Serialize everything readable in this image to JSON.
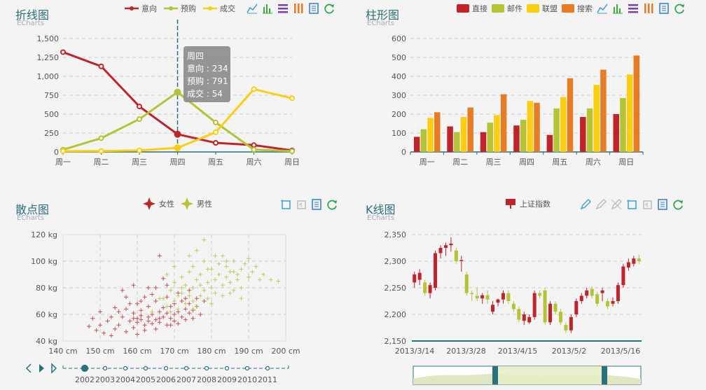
{
  "colors": {
    "red": "#c1232b",
    "green": "#b5c334",
    "yellow": "#fcce10",
    "orange": "#e87c25",
    "teal": "#27727b",
    "tooltipBg": "#8f8f8f"
  },
  "toolbox_icons": {
    "line": [
      "line-chart-icon",
      "bar-chart-icon",
      "stack-icon",
      "tiled-icon",
      "data-view-icon",
      "restore-icon"
    ],
    "bar": [
      "line-chart-icon",
      "bar-chart-icon",
      "stack-icon",
      "tiled-icon",
      "data-view-icon",
      "restore-icon"
    ],
    "scatter": [
      "zoom-select-icon",
      "zoom-reset-icon",
      "data-view-icon",
      "restore-icon"
    ],
    "kline": [
      "mark-icon",
      "mark-undo-icon",
      "mark-clear-icon",
      "zoom-select-icon",
      "zoom-reset-icon",
      "data-view-icon",
      "restore-icon"
    ]
  },
  "panels": {
    "line": {
      "title": "折线图",
      "subtitle": "ECharts"
    },
    "bar": {
      "title": "柱形图",
      "subtitle": "ECharts"
    },
    "scatter": {
      "title": "散点图",
      "subtitle": "ECharts"
    },
    "kline": {
      "title": "K线图",
      "subtitle": "ECharts"
    }
  },
  "chart_data": [
    {
      "type": "line",
      "categories": [
        "周一",
        "周二",
        "周三",
        "周四",
        "周五",
        "周六",
        "周日"
      ],
      "ylim": [
        0,
        1500
      ],
      "yticks": [
        "0",
        "250",
        "500",
        "750",
        "1,000",
        "1,250",
        "1,500"
      ],
      "series": [
        {
          "name": "意向",
          "values": [
            1320,
            1132,
            601,
            234,
            120,
            90,
            20
          ]
        },
        {
          "name": "预购",
          "values": [
            30,
            182,
            434,
            791,
            390,
            30,
            10
          ]
        },
        {
          "name": "成交",
          "values": [
            10,
            12,
            21,
            54,
            260,
            830,
            710
          ]
        }
      ],
      "tooltip": {
        "title": "周四",
        "lines": [
          "意向 : 234",
          "预购 : 791",
          "成交 : 54"
        ]
      }
    },
    {
      "type": "bar",
      "categories": [
        "周一",
        "周二",
        "周三",
        "周四",
        "周五",
        "周六",
        "周日"
      ],
      "ylim": [
        0,
        600
      ],
      "yticks": [
        "0",
        "100",
        "200",
        "300",
        "400",
        "500",
        "600"
      ],
      "series": [
        {
          "name": "直接",
          "values": [
            80,
            135,
            105,
            140,
            90,
            185,
            200
          ]
        },
        {
          "name": "邮件",
          "values": [
            120,
            105,
            155,
            170,
            230,
            230,
            285
          ]
        },
        {
          "name": "联盟",
          "values": [
            180,
            185,
            195,
            270,
            290,
            355,
            410
          ]
        },
        {
          "name": "搜索",
          "values": [
            210,
            235,
            305,
            260,
            390,
            435,
            510
          ]
        }
      ]
    },
    {
      "type": "scatter",
      "xlim": [
        140,
        200
      ],
      "ylim": [
        40,
        120
      ],
      "xticks": [
        "140 cm",
        "150 cm",
        "160 cm",
        "170 cm",
        "180 cm",
        "190 cm",
        "200 cm"
      ],
      "yticks": [
        "40 kg",
        "60 kg",
        "80 kg",
        "100 kg",
        "120 kg"
      ],
      "series": [
        {
          "name": "女性",
          "values": [
            [
              147,
              51
            ],
            [
              149,
              48
            ],
            [
              151,
              46
            ],
            [
              152,
              55
            ],
            [
              153,
              44
            ],
            [
              154,
              49
            ],
            [
              155,
              52
            ],
            [
              156,
              58
            ],
            [
              157,
              47
            ],
            [
              158,
              55
            ],
            [
              159,
              61
            ],
            [
              159,
              50
            ],
            [
              160,
              54
            ],
            [
              160,
              45
            ],
            [
              161,
              63
            ],
            [
              161,
              56
            ],
            [
              162,
              52
            ],
            [
              162,
              48
            ],
            [
              163,
              58
            ],
            [
              163,
              66
            ],
            [
              164,
              53
            ],
            [
              164,
              60
            ],
            [
              165,
              56
            ],
            [
              165,
              49
            ],
            [
              165,
              70
            ],
            [
              166,
              62
            ],
            [
              166,
              54
            ],
            [
              167,
              58
            ],
            [
              167,
              65
            ],
            [
              168,
              52
            ],
            [
              168,
              61
            ],
            [
              168,
              73
            ],
            [
              169,
              57
            ],
            [
              169,
              66
            ],
            [
              170,
              55
            ],
            [
              170,
              60
            ],
            [
              170,
              68
            ],
            [
              171,
              62
            ],
            [
              171,
              53
            ],
            [
              172,
              58
            ],
            [
              172,
              70
            ],
            [
              173,
              64
            ],
            [
              173,
              56
            ],
            [
              174,
              61
            ],
            [
              174,
              68
            ],
            [
              175,
              63
            ],
            [
              175,
              57
            ],
            [
              176,
              66
            ],
            [
              177,
              60
            ],
            [
              178,
              70
            ],
            [
              156,
              78
            ],
            [
              159,
              82
            ],
            [
              163,
              80
            ],
            [
              166,
              104
            ],
            [
              160,
              68
            ],
            [
              162,
              73
            ],
            [
              164,
              75
            ],
            [
              157,
              64
            ],
            [
              158,
              68
            ],
            [
              161,
              59
            ],
            [
              153,
              58
            ],
            [
              155,
              62
            ],
            [
              150,
              52
            ],
            [
              168,
              82
            ],
            [
              171,
              76
            ],
            [
              159,
              57
            ],
            [
              160,
              57
            ],
            [
              163,
              55
            ],
            [
              166,
              57
            ],
            [
              169,
              52
            ],
            [
              173,
              72
            ],
            [
              165,
              80
            ],
            [
              167,
              87
            ],
            [
              174,
              78
            ],
            [
              176,
              72
            ],
            [
              150,
              62
            ],
            [
              148,
              57
            ],
            [
              161,
              70
            ],
            [
              157,
              73
            ],
            [
              154,
              65
            ]
          ]
        },
        {
          "name": "男性",
          "values": [
            [
              164,
              62
            ],
            [
              166,
              72
            ],
            [
              168,
              66
            ],
            [
              169,
              78
            ],
            [
              170,
              70
            ],
            [
              170,
              84
            ],
            [
              171,
              64
            ],
            [
              172,
              76
            ],
            [
              172,
              88
            ],
            [
              173,
              68
            ],
            [
              173,
              82
            ],
            [
              174,
              74
            ],
            [
              174,
              92
            ],
            [
              175,
              70
            ],
            [
              175,
              80
            ],
            [
              175,
              96
            ],
            [
              176,
              66
            ],
            [
              176,
              86
            ],
            [
              177,
              74
            ],
            [
              177,
              90
            ],
            [
              178,
              78
            ],
            [
              178,
              100
            ],
            [
              178,
              116
            ],
            [
              179,
              72
            ],
            [
              179,
              84
            ],
            [
              180,
              80
            ],
            [
              180,
              94
            ],
            [
              180,
              68
            ],
            [
              181,
              86
            ],
            [
              181,
              76
            ],
            [
              182,
              90
            ],
            [
              182,
              98
            ],
            [
              183,
              82
            ],
            [
              183,
              74
            ],
            [
              184,
              88
            ],
            [
              184,
              96
            ],
            [
              185,
              84
            ],
            [
              185,
              92
            ],
            [
              186,
              78
            ],
            [
              186,
              100
            ],
            [
              187,
              90
            ],
            [
              187,
              86
            ],
            [
              188,
              94
            ],
            [
              188,
              80
            ],
            [
              189,
              98
            ],
            [
              190,
              88
            ],
            [
              190,
              102
            ],
            [
              191,
              92
            ],
            [
              192,
              96
            ],
            [
              193,
              86
            ],
            [
              194,
              90
            ],
            [
              196,
              86
            ],
            [
              198,
              85
            ],
            [
              176,
              108
            ],
            [
              174,
              104
            ],
            [
              170,
              96
            ],
            [
              168,
              90
            ],
            [
              171,
              74
            ],
            [
              177,
              82
            ],
            [
              183,
              104
            ],
            [
              186,
              92
            ],
            [
              188,
              72
            ],
            [
              179,
              94
            ],
            [
              172,
              80
            ],
            [
              175,
              64
            ],
            [
              181,
              104
            ],
            [
              185,
              76
            ],
            [
              167,
              72
            ],
            [
              169,
              62
            ],
            [
              184,
              100
            ]
          ]
        }
      ],
      "timeline": {
        "years": [
          "2002",
          "2003",
          "2004",
          "2005",
          "2006",
          "2007",
          "2008",
          "2009",
          "2010",
          "2011"
        ],
        "current": "2002"
      }
    },
    {
      "type": "candlestick",
      "series": [
        {
          "name": "上证指数"
        }
      ],
      "ylim": [
        2150,
        2350
      ],
      "yticks": [
        "2,150",
        "2,200",
        "2,250",
        "2,300",
        "2,350"
      ],
      "xticks": [
        "2013/3/14",
        "2013/3/28",
        "2013/4/15",
        "2013/5/2",
        "2013/5/16"
      ],
      "values": [
        [
          2260,
          2275,
          2250,
          2280
        ],
        [
          2265,
          2278,
          2255,
          2285
        ],
        [
          2260,
          2240,
          2235,
          2265
        ],
        [
          2240,
          2255,
          2230,
          2260
        ],
        [
          2250,
          2315,
          2245,
          2320
        ],
        [
          2315,
          2325,
          2305,
          2330
        ],
        [
          2325,
          2330,
          2310,
          2335
        ],
        [
          2330,
          2333,
          2318,
          2345
        ],
        [
          2320,
          2300,
          2295,
          2325
        ],
        [
          2300,
          2302,
          2280,
          2310
        ],
        [
          2275,
          2240,
          2235,
          2280
        ],
        [
          2240,
          2238,
          2225,
          2245
        ],
        [
          2235,
          2230,
          2225,
          2250
        ],
        [
          2230,
          2236,
          2220,
          2240
        ],
        [
          2236,
          2228,
          2220,
          2245
        ],
        [
          2205,
          2218,
          2200,
          2225
        ],
        [
          2222,
          2228,
          2215,
          2230
        ],
        [
          2228,
          2240,
          2220,
          2245
        ],
        [
          2240,
          2225,
          2220,
          2245
        ],
        [
          2220,
          2210,
          2205,
          2225
        ],
        [
          2210,
          2190,
          2185,
          2215
        ],
        [
          2188,
          2200,
          2180,
          2205
        ],
        [
          2185,
          2195,
          2182,
          2200
        ],
        [
          2195,
          2240,
          2190,
          2245
        ],
        [
          2240,
          2235,
          2230,
          2245
        ],
        [
          2245,
          2185,
          2180,
          2250
        ],
        [
          2185,
          2220,
          2180,
          2225
        ],
        [
          2220,
          2205,
          2200,
          2225
        ],
        [
          2205,
          2185,
          2180,
          2210
        ],
        [
          2180,
          2170,
          2165,
          2185
        ],
        [
          2170,
          2195,
          2165,
          2200
        ],
        [
          2200,
          2225,
          2195,
          2230
        ],
        [
          2225,
          2235,
          2220,
          2240
        ],
        [
          2235,
          2245,
          2230,
          2250
        ],
        [
          2248,
          2235,
          2230,
          2252
        ],
        [
          2238,
          2220,
          2215,
          2242
        ],
        [
          2240,
          2245,
          2225,
          2250
        ],
        [
          2225,
          2215,
          2210,
          2230
        ],
        [
          2220,
          2225,
          2215,
          2232
        ],
        [
          2225,
          2255,
          2220,
          2260
        ],
        [
          2255,
          2290,
          2250,
          2295
        ],
        [
          2288,
          2298,
          2282,
          2305
        ],
        [
          2295,
          2305,
          2290,
          2310
        ],
        [
          2305,
          2300,
          2295,
          2312
        ]
      ]
    }
  ]
}
